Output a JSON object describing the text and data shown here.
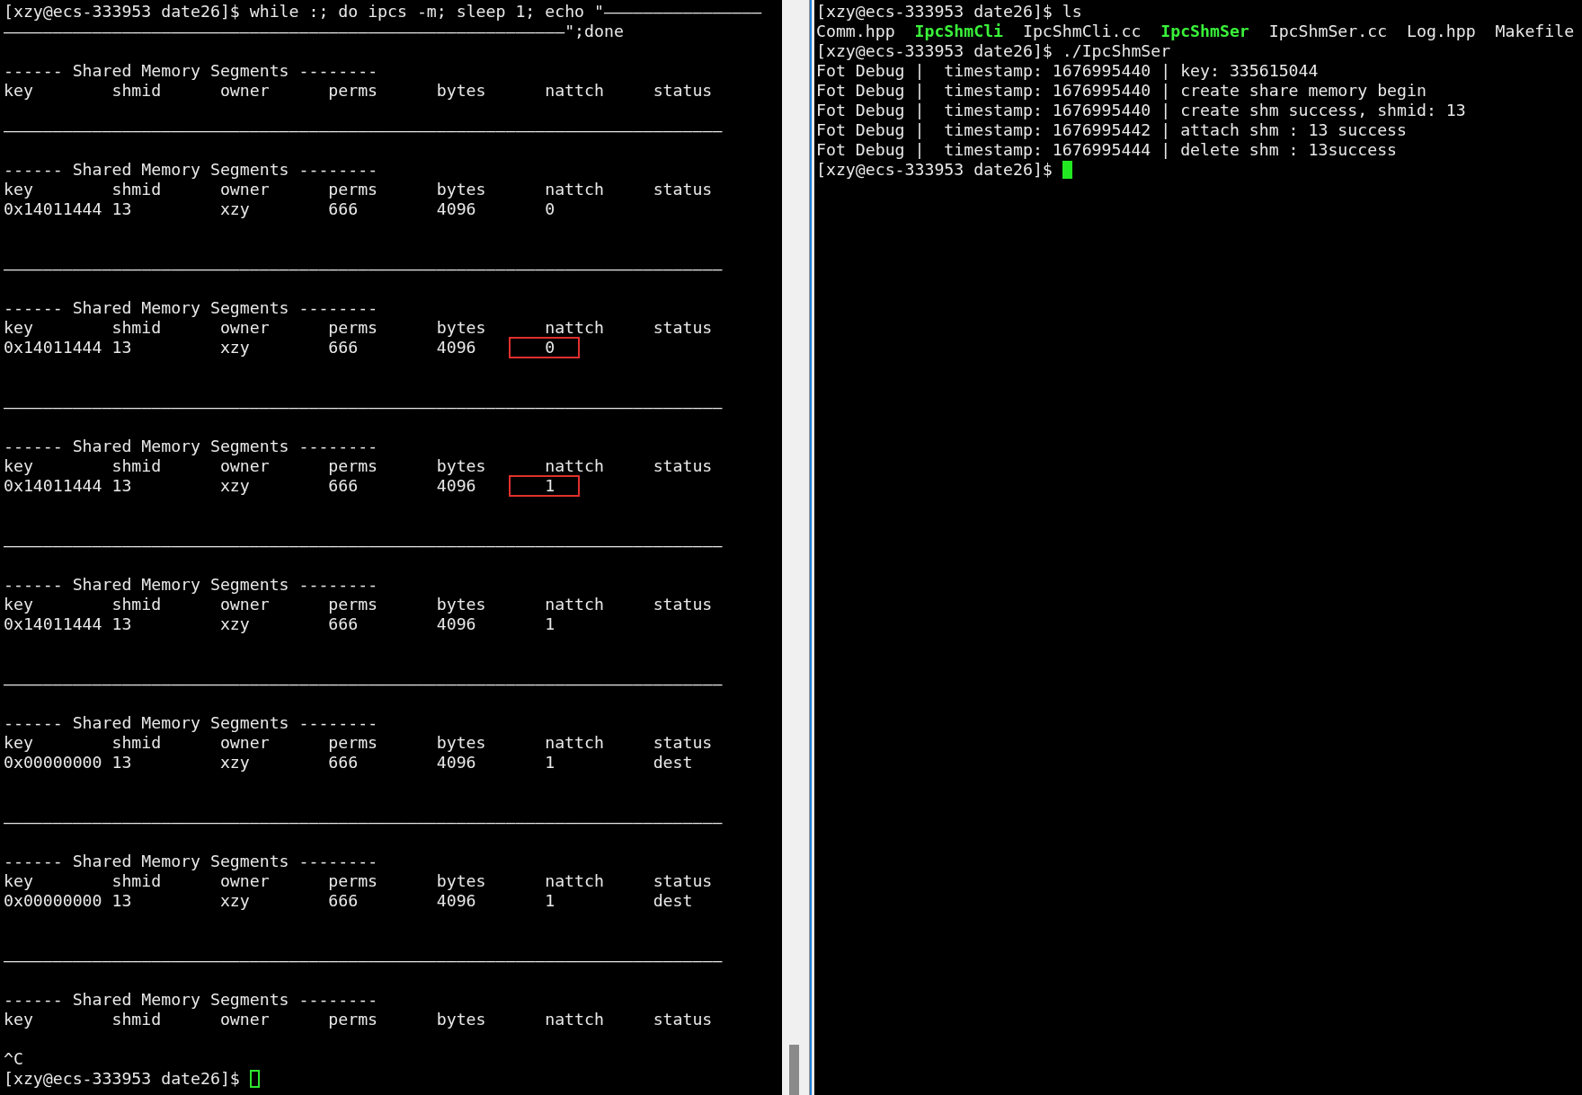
{
  "left_terminal": {
    "lines": [
      {
        "kind": "text",
        "text": "[xzy@ecs-333953 date26]$ while :; do ipcs -m; sleep 1; echo \"————————————————"
      },
      {
        "kind": "text",
        "text": "—————————————————————————————————————————————————————————\";done"
      },
      {
        "kind": "blank"
      },
      {
        "kind": "text",
        "text": "------ Shared Memory Segments --------"
      },
      {
        "kind": "header",
        "cells": [
          "key",
          "shmid",
          "owner",
          "perms",
          "bytes",
          "nattch",
          "status"
        ]
      },
      {
        "kind": "blank"
      },
      {
        "kind": "text",
        "text": "—————————————————————————————————————————————————————————————————————————"
      },
      {
        "kind": "blank"
      },
      {
        "kind": "text",
        "text": "------ Shared Memory Segments --------"
      },
      {
        "kind": "header",
        "cells": [
          "key",
          "shmid",
          "owner",
          "perms",
          "bytes",
          "nattch",
          "status"
        ]
      },
      {
        "kind": "row",
        "cells": [
          "0x14011444",
          "13",
          "xzy",
          "666",
          "4096",
          "0"
        ],
        "boxed": false
      },
      {
        "kind": "blank"
      },
      {
        "kind": "blank"
      },
      {
        "kind": "text",
        "text": "—————————————————————————————————————————————————————————————————————————"
      },
      {
        "kind": "blank"
      },
      {
        "kind": "text",
        "text": "------ Shared Memory Segments --------"
      },
      {
        "kind": "header",
        "cells": [
          "key",
          "shmid",
          "owner",
          "perms",
          "bytes",
          "nattch",
          "status"
        ]
      },
      {
        "kind": "row",
        "cells": [
          "0x14011444",
          "13",
          "xzy",
          "666",
          "4096",
          "0"
        ],
        "boxed": true
      },
      {
        "kind": "blank"
      },
      {
        "kind": "blank"
      },
      {
        "kind": "text",
        "text": "—————————————————————————————————————————————————————————————————————————"
      },
      {
        "kind": "blank"
      },
      {
        "kind": "text",
        "text": "------ Shared Memory Segments --------"
      },
      {
        "kind": "header",
        "cells": [
          "key",
          "shmid",
          "owner",
          "perms",
          "bytes",
          "nattch",
          "status"
        ]
      },
      {
        "kind": "row",
        "cells": [
          "0x14011444",
          "13",
          "xzy",
          "666",
          "4096",
          "1"
        ],
        "boxed": true
      },
      {
        "kind": "blank"
      },
      {
        "kind": "blank"
      },
      {
        "kind": "text",
        "text": "—————————————————————————————————————————————————————————————————————————"
      },
      {
        "kind": "blank"
      },
      {
        "kind": "text",
        "text": "------ Shared Memory Segments --------"
      },
      {
        "kind": "header",
        "cells": [
          "key",
          "shmid",
          "owner",
          "perms",
          "bytes",
          "nattch",
          "status"
        ]
      },
      {
        "kind": "row",
        "cells": [
          "0x14011444",
          "13",
          "xzy",
          "666",
          "4096",
          "1"
        ],
        "boxed": false
      },
      {
        "kind": "blank"
      },
      {
        "kind": "blank"
      },
      {
        "kind": "text",
        "text": "—————————————————————————————————————————————————————————————————————————"
      },
      {
        "kind": "blank"
      },
      {
        "kind": "text",
        "text": "------ Shared Memory Segments --------"
      },
      {
        "kind": "header",
        "cells": [
          "key",
          "shmid",
          "owner",
          "perms",
          "bytes",
          "nattch",
          "status"
        ]
      },
      {
        "kind": "row",
        "cells": [
          "0x00000000",
          "13",
          "xzy",
          "666",
          "4096",
          "1",
          "dest"
        ],
        "boxed": false
      },
      {
        "kind": "blank"
      },
      {
        "kind": "blank"
      },
      {
        "kind": "text",
        "text": "—————————————————————————————————————————————————————————————————————————"
      },
      {
        "kind": "blank"
      },
      {
        "kind": "text",
        "text": "------ Shared Memory Segments --------"
      },
      {
        "kind": "header",
        "cells": [
          "key",
          "shmid",
          "owner",
          "perms",
          "bytes",
          "nattch",
          "status"
        ]
      },
      {
        "kind": "row",
        "cells": [
          "0x00000000",
          "13",
          "xzy",
          "666",
          "4096",
          "1",
          "dest"
        ],
        "boxed": false
      },
      {
        "kind": "blank"
      },
      {
        "kind": "blank"
      },
      {
        "kind": "text",
        "text": "—————————————————————————————————————————————————————————————————————————"
      },
      {
        "kind": "blank"
      },
      {
        "kind": "text",
        "text": "------ Shared Memory Segments --------"
      },
      {
        "kind": "header",
        "cells": [
          "key",
          "shmid",
          "owner",
          "perms",
          "bytes",
          "nattch",
          "status"
        ]
      },
      {
        "kind": "blank"
      },
      {
        "kind": "text",
        "text": "^C"
      },
      {
        "kind": "prompt",
        "text": "[xzy@ecs-333953 date26]$",
        "cursor_filled": false
      }
    ]
  },
  "right_terminal": {
    "lines": [
      {
        "kind": "text",
        "text": "[xzy@ecs-333953 date26]$ ls"
      },
      {
        "kind": "files",
        "files": [
          {
            "name": "Comm.hpp",
            "executable": false
          },
          {
            "name": "IpcShmCli",
            "executable": true
          },
          {
            "name": "IpcShmCli.cc",
            "executable": false
          },
          {
            "name": "IpcShmSer",
            "executable": true
          },
          {
            "name": "IpcShmSer.cc",
            "executable": false
          },
          {
            "name": "Log.hpp",
            "executable": false
          },
          {
            "name": "Makefile",
            "executable": false
          }
        ]
      },
      {
        "kind": "text",
        "text": "[xzy@ecs-333953 date26]$ ./IpcShmSer"
      },
      {
        "kind": "text",
        "text": "Fot Debug |  timestamp: 1676995440 | key: 335615044"
      },
      {
        "kind": "text",
        "text": "Fot Debug |  timestamp: 1676995440 | create share memory begin"
      },
      {
        "kind": "text",
        "text": "Fot Debug |  timestamp: 1676995440 | create shm success, shmid: 13"
      },
      {
        "kind": "text",
        "text": "Fot Debug |  timestamp: 1676995442 | attach shm : 13 success"
      },
      {
        "kind": "text",
        "text": "Fot Debug |  timestamp: 1676995444 | delete shm : 13success"
      },
      {
        "kind": "prompt",
        "text": "[xzy@ecs-333953 date26]$",
        "cursor_filled": true
      }
    ]
  }
}
